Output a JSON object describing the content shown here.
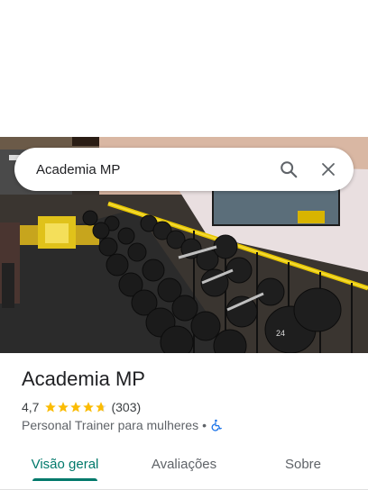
{
  "search": {
    "query": "Academia MP",
    "search_icon": "search-icon",
    "close_icon": "close-icon"
  },
  "place": {
    "name": "Academia MP",
    "rating": "4,7",
    "rating_value": 4.7,
    "review_count": "(303)",
    "category": "Personal Trainer para mulheres",
    "separator": "•",
    "accessibility_icon": "wheelchair-icon"
  },
  "tabs": [
    {
      "label": "Visão geral",
      "active": true
    },
    {
      "label": "Avaliações",
      "active": false
    },
    {
      "label": "Sobre",
      "active": false
    }
  ],
  "colors": {
    "accent": "#00796b",
    "star": "#fbbc04",
    "accessibility": "#1a73e8"
  }
}
